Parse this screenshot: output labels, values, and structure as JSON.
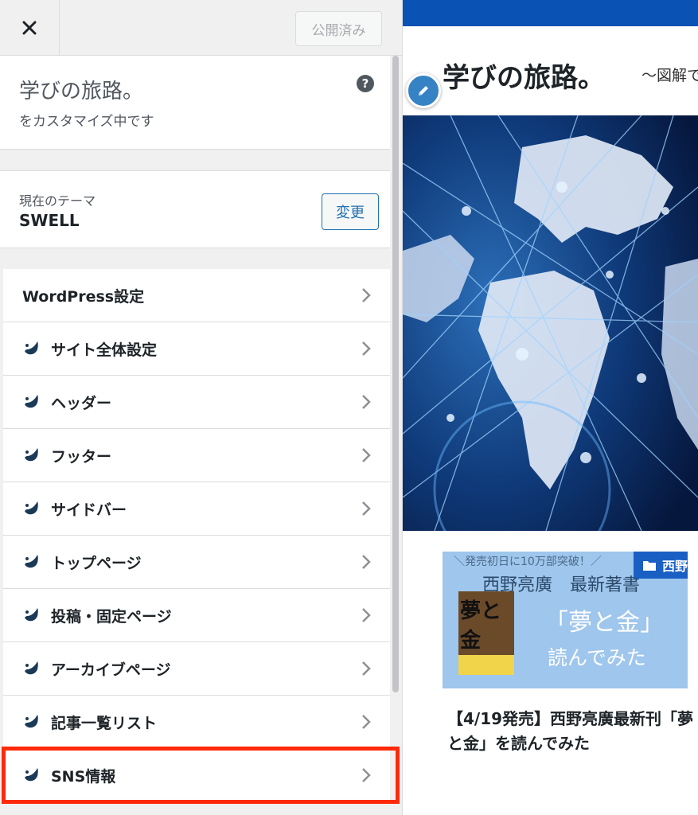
{
  "header": {
    "publish_label": "公開済み"
  },
  "site_info": {
    "title": "学びの旅路。",
    "customizing": "をカスタマイズ中です"
  },
  "theme": {
    "label": "現在のテーマ",
    "name": "SWELL",
    "change_label": "変更"
  },
  "menu": {
    "items": [
      {
        "label": "WordPress設定",
        "icon": "none"
      },
      {
        "label": "サイト全体設定",
        "icon": "swell-leaf-icon"
      },
      {
        "label": "ヘッダー",
        "icon": "swell-leaf-icon"
      },
      {
        "label": "フッター",
        "icon": "swell-leaf-icon"
      },
      {
        "label": "サイドバー",
        "icon": "swell-leaf-icon"
      },
      {
        "label": "トップページ",
        "icon": "swell-leaf-icon"
      },
      {
        "label": "投稿・固定ページ",
        "icon": "swell-leaf-icon"
      },
      {
        "label": "アーカイブページ",
        "icon": "swell-leaf-icon"
      },
      {
        "label": "記事一覧リスト",
        "icon": "swell-leaf-icon"
      },
      {
        "label": "SNS情報",
        "icon": "swell-leaf-icon"
      }
    ],
    "highlighted": "SNS情報"
  },
  "preview": {
    "site_title": "学びの旅路。",
    "tagline": "〜図解で",
    "card": {
      "top_text": "＼発売初日に10万部突破！／",
      "author_text": "西野亮廣　最新著書",
      "book_text": "「夢と金」",
      "read_text": "読んでみた",
      "cover_text": "夢と金",
      "category": "西野亮廣"
    },
    "post_title": "【4/19発売】西野亮廣最新刊「夢と金」を読んでみた"
  },
  "colors": {
    "accent": "#2271b1",
    "highlight": "#ff2a0a",
    "preview_header": "#0b52b5",
    "card_bg": "#9fc6ec"
  }
}
